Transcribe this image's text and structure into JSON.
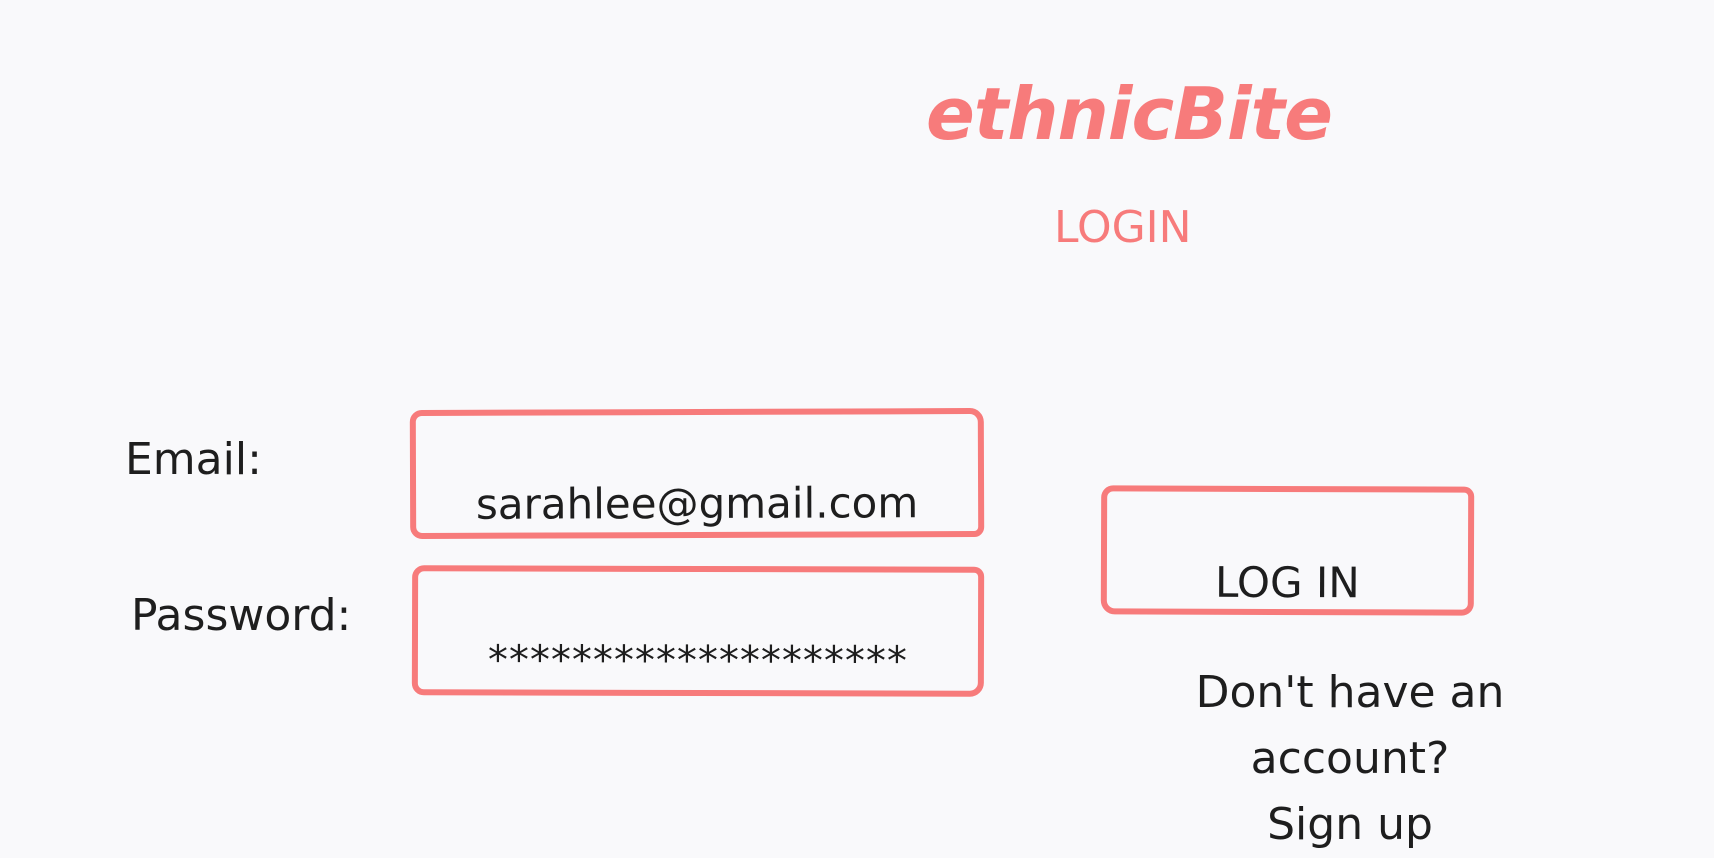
{
  "brand": {
    "name": "ethnicBite",
    "color": "#f77b7b"
  },
  "page": {
    "heading": "LOGIN",
    "background": "#f9f9fb"
  },
  "form": {
    "email": {
      "label": "Email:",
      "value": "sarahlee@gmail.com"
    },
    "password": {
      "label": "Password:",
      "value": "********************"
    },
    "submit_label": "LOG IN"
  },
  "signup": {
    "prompt": "Don't have an account?",
    "link_label": "Sign up"
  }
}
